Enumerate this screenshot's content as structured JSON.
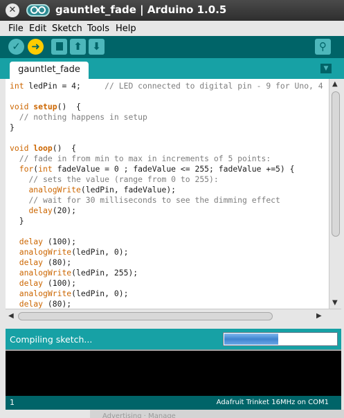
{
  "window": {
    "title": "gauntlet_fade | Arduino 1.0.5"
  },
  "menu": [
    "File",
    "Edit",
    "Sketch",
    "Tools",
    "Help"
  ],
  "toolbar": {
    "verify_icon": "checkmark-icon",
    "upload_icon": "right-arrow-icon",
    "new_icon": "document-icon",
    "open_icon": "up-arrow-icon",
    "save_icon": "down-arrow-icon",
    "serial_icon": "magnifier-icon"
  },
  "tab": {
    "name": "gauntlet_fade"
  },
  "code_lines": [
    [
      {
        "t": "int",
        "c": "kw"
      },
      {
        "t": " ledPin = 4;     "
      },
      {
        "t": "// LED connected to digital pin - 9 for Uno, 4",
        "c": "cm"
      }
    ],
    [],
    [
      {
        "t": "void",
        "c": "kw"
      },
      {
        "t": " "
      },
      {
        "t": "setup",
        "c": "kwb"
      },
      {
        "t": "()  {"
      }
    ],
    [
      {
        "t": "  "
      },
      {
        "t": "// nothing happens in setup",
        "c": "cm"
      }
    ],
    [
      {
        "t": "}"
      }
    ],
    [],
    [
      {
        "t": "void",
        "c": "kw"
      },
      {
        "t": " "
      },
      {
        "t": "loop",
        "c": "kwb"
      },
      {
        "t": "()  {"
      }
    ],
    [
      {
        "t": "  "
      },
      {
        "t": "// fade in from min to max in increments of 5 points:",
        "c": "cm"
      }
    ],
    [
      {
        "t": "  "
      },
      {
        "t": "for",
        "c": "kw"
      },
      {
        "t": "("
      },
      {
        "t": "int",
        "c": "kw"
      },
      {
        "t": " fadeValue = 0 ; fadeValue <= 255; fadeValue +=5) {"
      }
    ],
    [
      {
        "t": "    "
      },
      {
        "t": "// sets the value (range from 0 to 255):",
        "c": "cm"
      }
    ],
    [
      {
        "t": "    "
      },
      {
        "t": "analogWrite",
        "c": "kw"
      },
      {
        "t": "(ledPin, fadeValue);"
      }
    ],
    [
      {
        "t": "    "
      },
      {
        "t": "// wait for 30 milliseconds to see the dimming effect",
        "c": "cm"
      }
    ],
    [
      {
        "t": "    "
      },
      {
        "t": "delay",
        "c": "kw"
      },
      {
        "t": "(20);"
      }
    ],
    [
      {
        "t": "  }"
      }
    ],
    [],
    [
      {
        "t": "  "
      },
      {
        "t": "delay",
        "c": "kw"
      },
      {
        "t": " (100);"
      }
    ],
    [
      {
        "t": "  "
      },
      {
        "t": "analogWrite",
        "c": "kw"
      },
      {
        "t": "(ledPin, 0);"
      }
    ],
    [
      {
        "t": "  "
      },
      {
        "t": "delay",
        "c": "kw"
      },
      {
        "t": " (80);"
      }
    ],
    [
      {
        "t": "  "
      },
      {
        "t": "analogWrite",
        "c": "kw"
      },
      {
        "t": "(ledPin, 255);"
      }
    ],
    [
      {
        "t": "  "
      },
      {
        "t": "delay",
        "c": "kw"
      },
      {
        "t": " (100);"
      }
    ],
    [
      {
        "t": "  "
      },
      {
        "t": "analogWrite",
        "c": "kw"
      },
      {
        "t": "(ledPin, 0);"
      }
    ],
    [
      {
        "t": "  "
      },
      {
        "t": "delay",
        "c": "kw"
      },
      {
        "t": " (80);"
      }
    ]
  ],
  "status": {
    "message": "Compiling sketch...",
    "progress": 0.475
  },
  "footer": {
    "line": "1",
    "board": "Adafruit Trinket 16MHz on COM1"
  },
  "background_window": {
    "text": "Advertising · Manage"
  },
  "colors": {
    "toolbar": "#006468",
    "tabbar": "#17a1a5",
    "button": "#4db7bb",
    "button_active": "#ffcc00",
    "keyword": "#cc6600",
    "comment": "#7e7e7e",
    "console": "#000000"
  }
}
